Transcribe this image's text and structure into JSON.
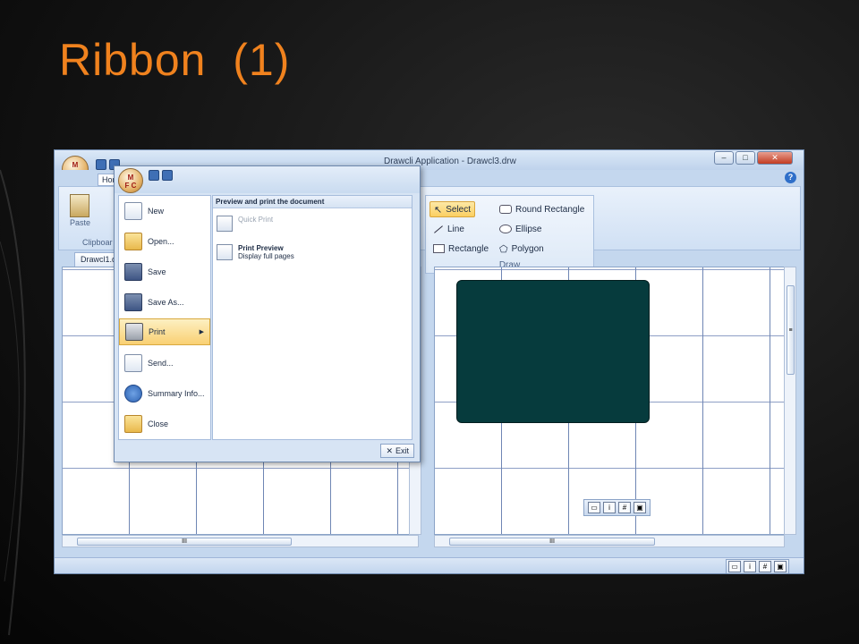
{
  "slide": {
    "title": "Ribbon",
    "title_num": "(1)"
  },
  "window": {
    "title": "Drawcli Application - Drawcl3.drw",
    "min": "–",
    "max": "□",
    "close": "✕",
    "help": "?"
  },
  "app_orb": {
    "label_top": "M",
    "label_bottom": "F C"
  },
  "ribbon": {
    "home_tab": "Hor",
    "clipboard_group": "Clipboar",
    "paste": "Paste",
    "draw_group": {
      "label": "Draw",
      "items": [
        "Select",
        "Line",
        "Rectangle",
        "Round Rectangle",
        "Ellipse",
        "Polygon"
      ]
    }
  },
  "documents": {
    "tab": "Drawcl1.dr"
  },
  "scroll": {
    "hthumb": "III",
    "vthumb": "≡"
  },
  "app_menu": {
    "items": [
      {
        "label": "New",
        "icon": "new-doc-icon"
      },
      {
        "label": "Open...",
        "icon": "folder-icon"
      },
      {
        "label": "Save",
        "icon": "disk-icon"
      },
      {
        "label": "Save As...",
        "icon": "save-as-icon"
      },
      {
        "label": "Print",
        "icon": "printer-icon"
      },
      {
        "label": "Send...",
        "icon": "send-icon"
      },
      {
        "label": "Summary Info...",
        "icon": "info-icon"
      },
      {
        "label": "Close",
        "icon": "close-folder-icon"
      }
    ],
    "panel_title": "Preview and print the document",
    "quick_print": "Quick Print",
    "print_preview": "Print Preview",
    "print_preview_desc": "Display full pages",
    "exit": "Exit"
  },
  "colors": {
    "title": "#f0821e",
    "shape_fill": "#063b3d",
    "highlight": "#fbcf62"
  }
}
